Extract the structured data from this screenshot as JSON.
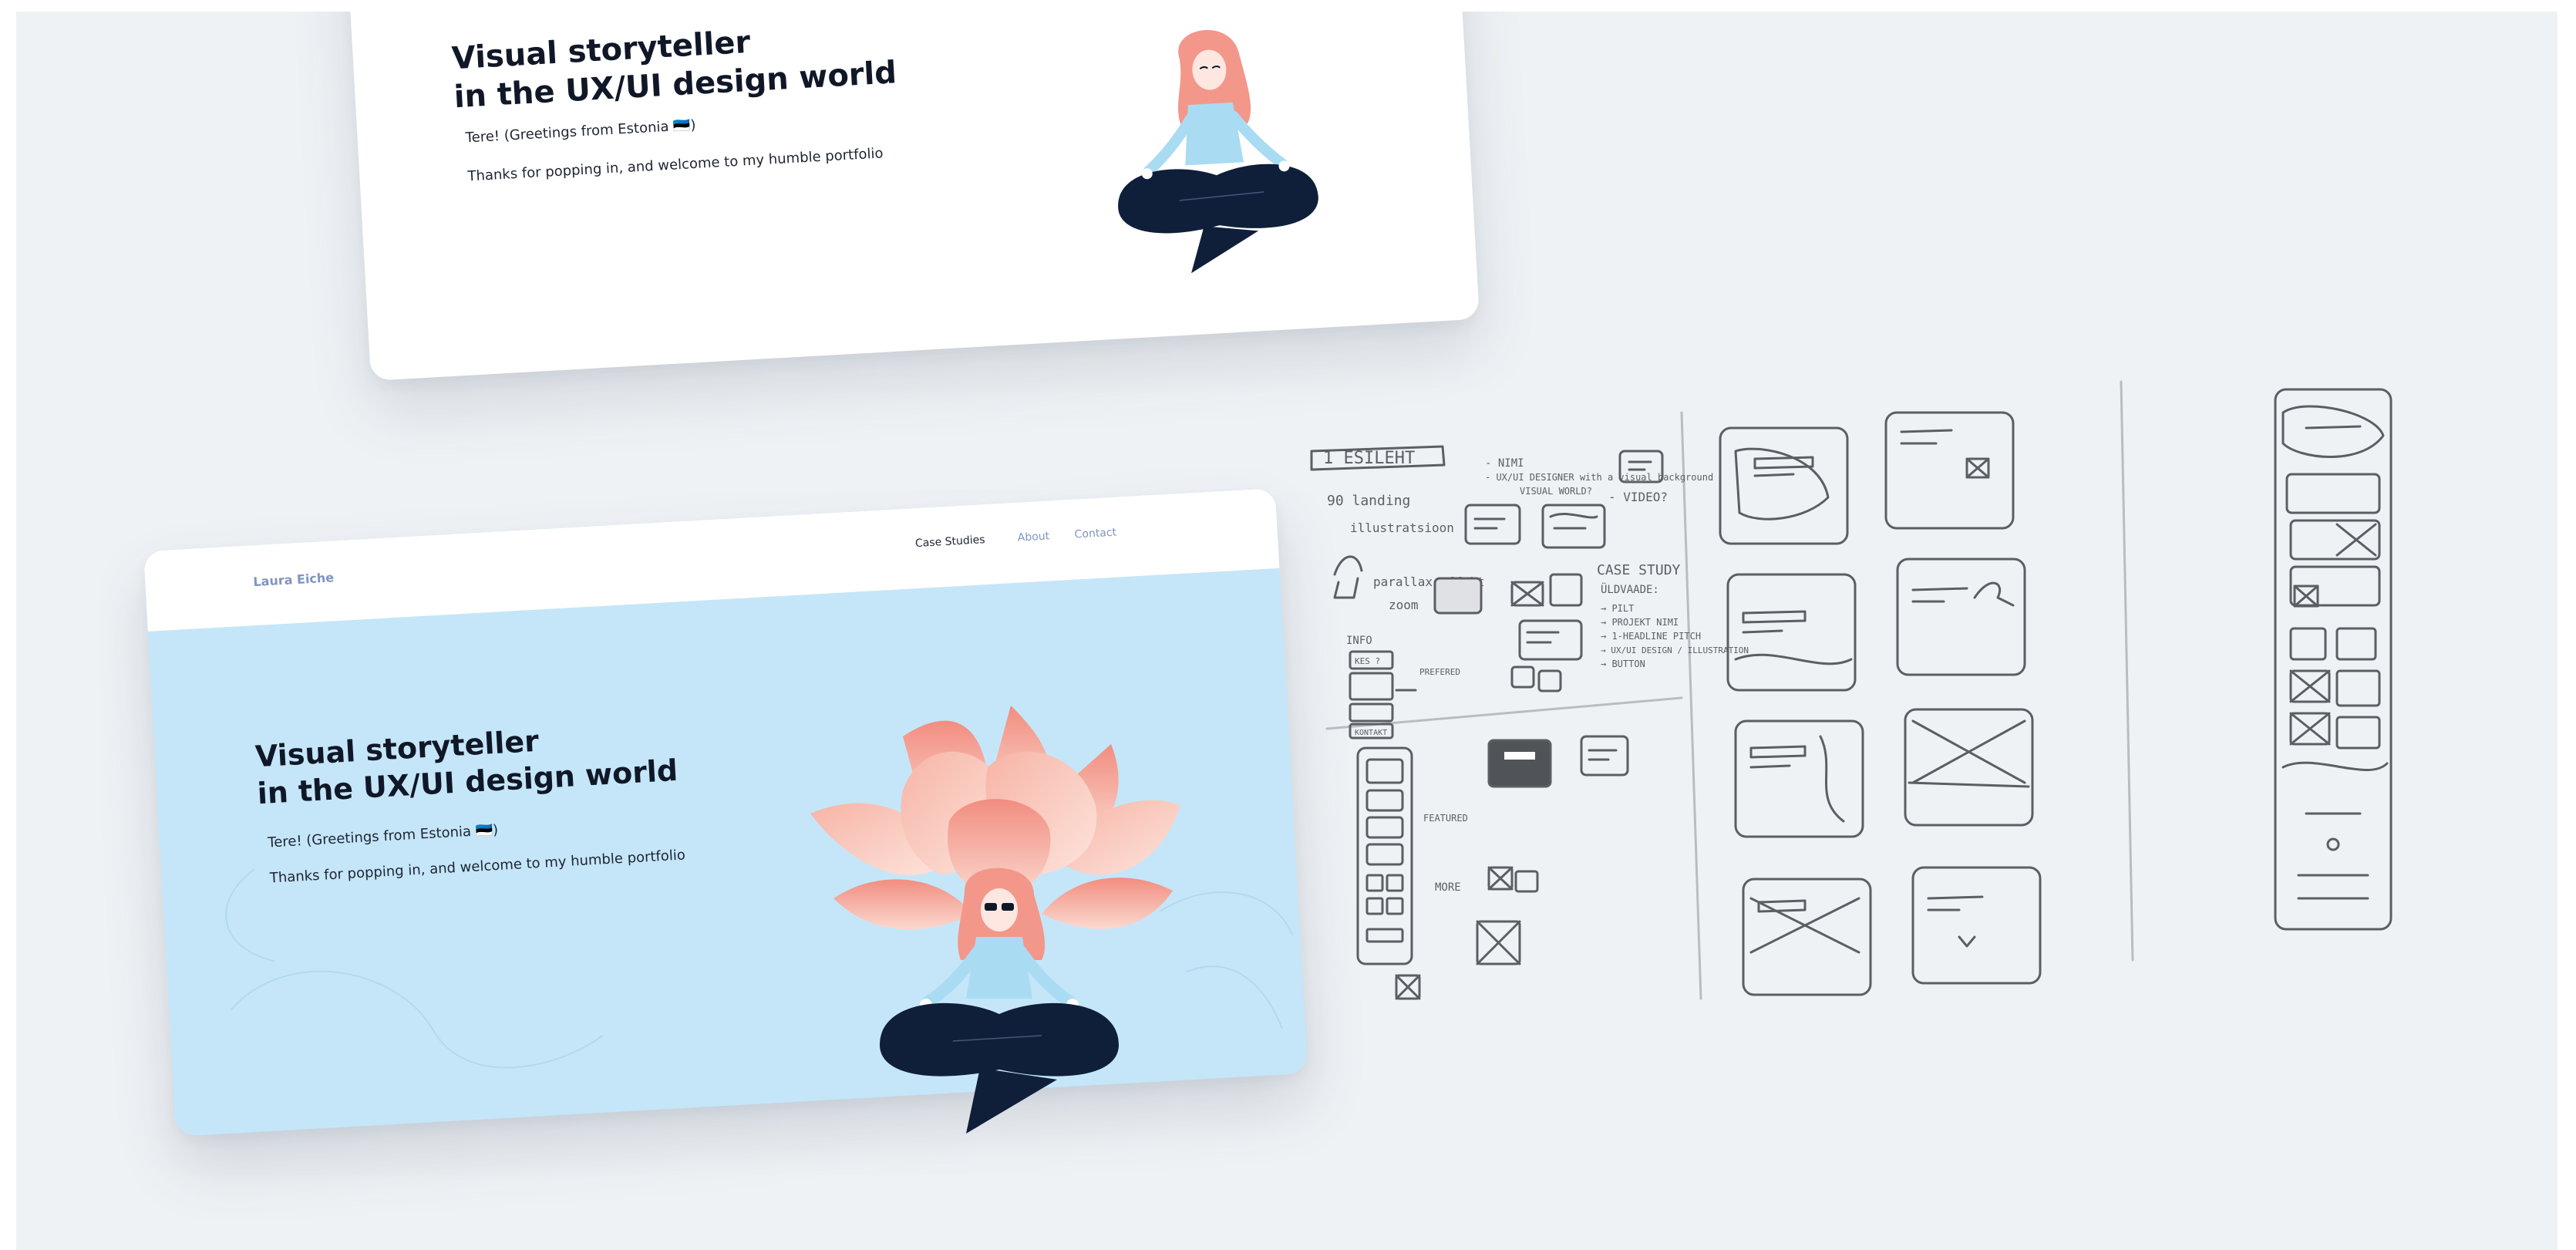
{
  "top_card": {
    "title": "Visual storyteller\nin the UX/UI design world",
    "greeting": "Tere! (Greetings from Estonia 🇪🇪)",
    "thanks": "Thanks for popping in, and welcome to my humble portfolio"
  },
  "main_card": {
    "brand": "Laura Eiche",
    "nav": {
      "case_studies": "Case Studies",
      "about": "About",
      "contact": "Contact"
    },
    "title": "Visual storyteller\nin the UX/UI design world",
    "greeting": "Tere! (Greetings from Estonia 🇪🇪)",
    "thanks": "Thanks for popping in, and welcome to my humble portfolio"
  },
  "sketch_notes": {
    "header": "1 ESILEHT",
    "landing": "90 landing",
    "illustration": "illustratsioon",
    "parallax": "parallax effekt",
    "zoom": "zoom",
    "nimi": "- NIMI",
    "uxui": "- UX/UI DESIGNER with a visual background",
    "visual_world": "VISUAL WORLD?",
    "video": "- VIDEO?",
    "case_study": "CASE STUDY",
    "uldvaade": "ÜLDVAADE:",
    "pilt": "→ PILT",
    "projekt": "→ PROJEKT NIMI",
    "headline": "→ 1-HEADLINE PITCH",
    "design": "→ UX/UI DESIGN / ILLUSTRATION",
    "button": "→ BUTTON",
    "info": "INFO",
    "kes": "KES ?",
    "preferred": "PREFERED",
    "kontakt": "KONTAKT",
    "featured": "FEATURED",
    "more": "MORE"
  },
  "colors": {
    "canvas": "#eff2f5",
    "hero_bg": "#c5e6f8",
    "ink": "#101828",
    "nav_muted": "#7f95c2",
    "lotus": "#f6a596",
    "hair": "#f3978b",
    "pants": "#0f1f3a",
    "sketch": "#5b5e63"
  }
}
